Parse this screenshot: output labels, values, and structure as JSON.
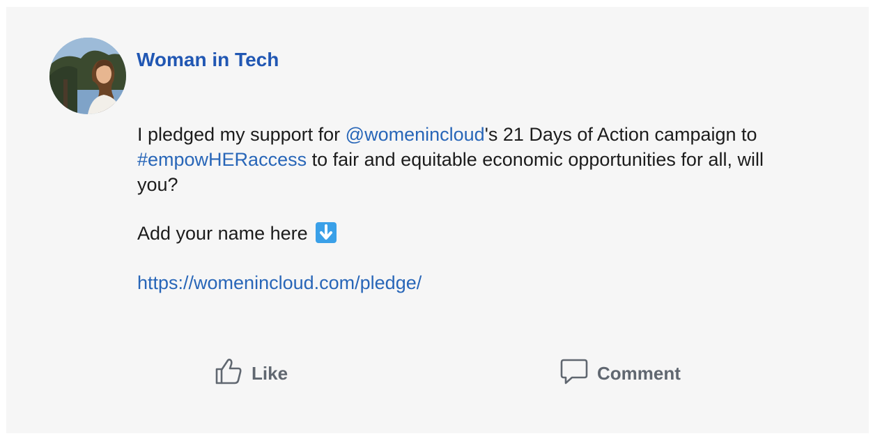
{
  "post": {
    "author": {
      "name": "Woman in Tech",
      "avatar_icon": "profile-photo"
    },
    "body": {
      "line1_prefix": "I pledged my support for ",
      "mention": "@womenincloud",
      "line1_suffix": "'s 21 Days of Action campaign to ",
      "hashtag": "#empowHERaccess",
      "line1_end": " to fair and equitable economic opportunities for all, will you?",
      "line2": "Add your name here",
      "line2_emoji": "down-arrow-emoji",
      "url": "https://womenincloud.com/pledge/"
    },
    "actions": {
      "like_label": "Like",
      "like_icon": "thumbs-up-icon",
      "comment_label": "Comment",
      "comment_icon": "speech-bubble-icon"
    }
  },
  "colors": {
    "card_background": "#f6f6f6",
    "author_name": "#2157b3",
    "link": "#2866b8",
    "body_text": "#1c1c1c",
    "action_text": "#606770",
    "emoji_blue": "#3aa0e8"
  }
}
